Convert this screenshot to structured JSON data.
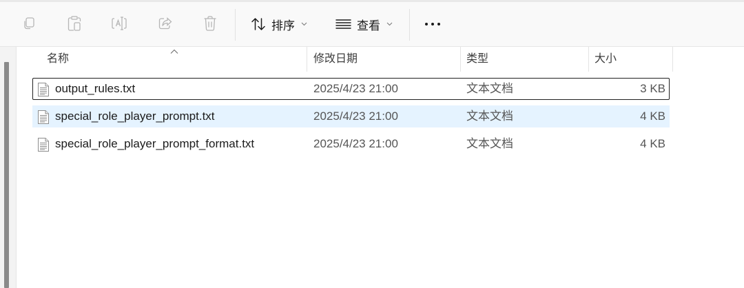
{
  "toolbar": {
    "sort_label": "排序",
    "view_label": "查看",
    "icons": [
      "copy-icon",
      "paste-icon",
      "rename-icon",
      "share-icon",
      "delete-icon",
      "sort-icon",
      "view-icon",
      "more-icon"
    ]
  },
  "columns": {
    "name": "名称",
    "date": "修改日期",
    "type": "类型",
    "size": "大小"
  },
  "files": [
    {
      "name": "output_rules.txt",
      "date": "2025/4/23 21:00",
      "type": "文本文档",
      "size": "3 KB",
      "state": "focused"
    },
    {
      "name": "special_role_player_prompt.txt",
      "date": "2025/4/23 21:00",
      "type": "文本文档",
      "size": "4 KB",
      "state": "selected"
    },
    {
      "name": "special_role_player_prompt_format.txt",
      "date": "2025/4/23 21:00",
      "type": "文本文档",
      "size": "4 KB",
      "state": "normal"
    }
  ],
  "colors": {
    "selection": "#e5f3ff",
    "focus_border": "#1f1f1f",
    "toolbar_bg": "#f9f9f9",
    "accent": "#0067c0"
  }
}
